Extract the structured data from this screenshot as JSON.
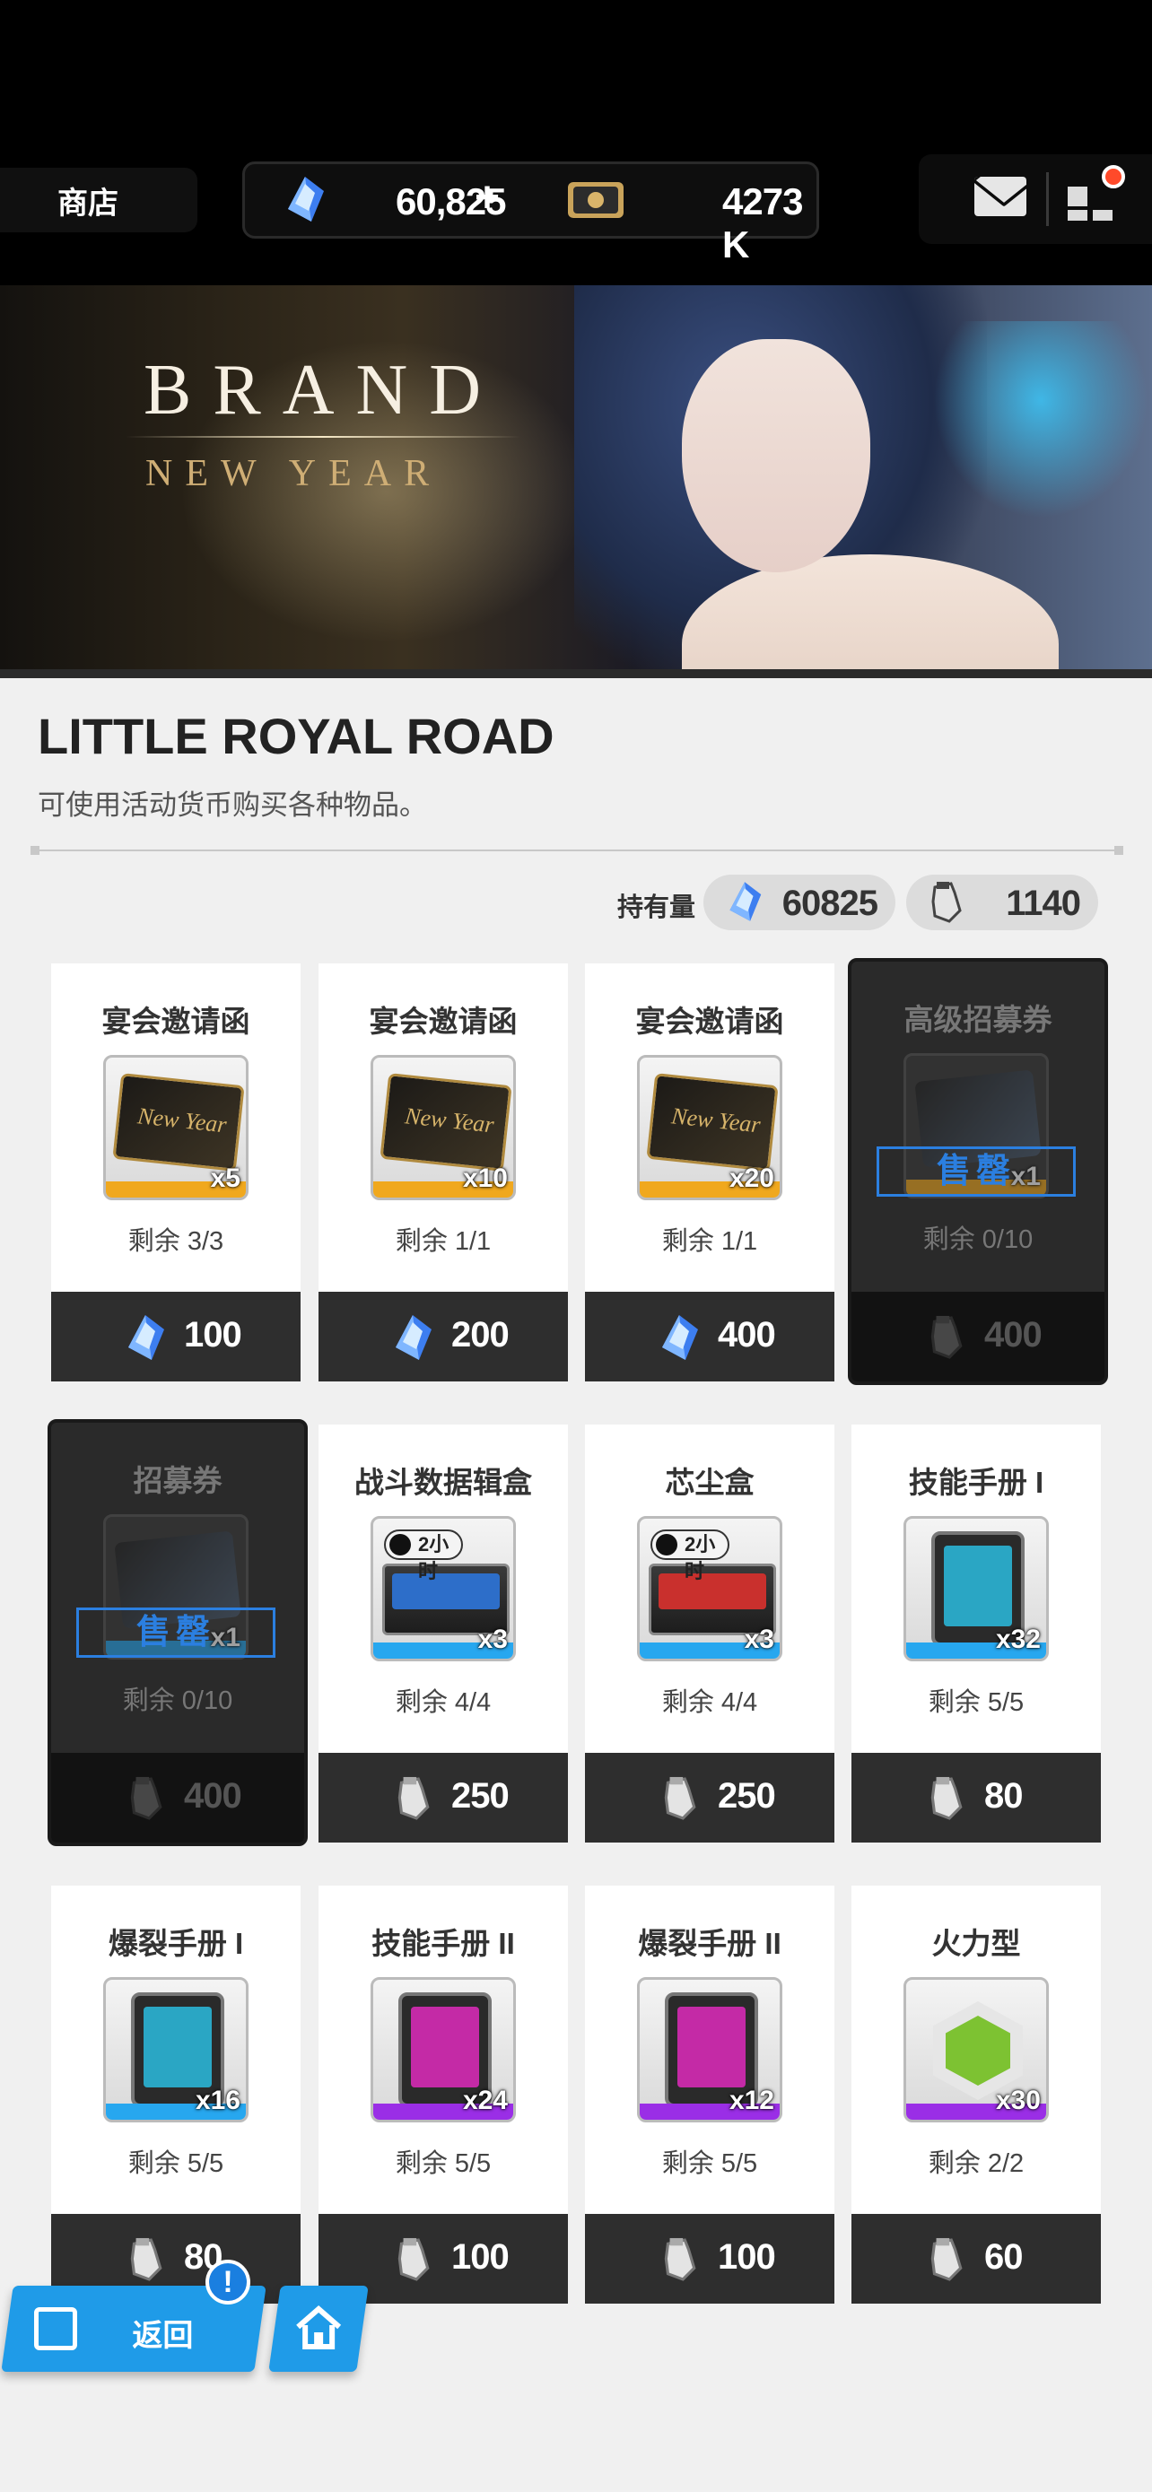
{
  "header": {
    "tab_label": "商店",
    "currency_gem": "60,825",
    "currency_credit": "4273 K",
    "add_symbol": "+"
  },
  "banner": {
    "title": "BRAND",
    "subtitle": "NEW YEAR"
  },
  "section": {
    "title": "LITTLE ROYAL ROAD",
    "description": "可使用活动货币购买各种物品。"
  },
  "holdings": {
    "label": "持有量",
    "gem": "60825",
    "token": "1140"
  },
  "sold_out_label": "售罄",
  "items": [
    {
      "name": "宴会邀请函",
      "qty": "x5",
      "remain": "剩余 3/3",
      "price": "100",
      "currency": "gem",
      "rarity": "gold",
      "sold_out": false
    },
    {
      "name": "宴会邀请函",
      "qty": "x10",
      "remain": "剩余 1/1",
      "price": "200",
      "currency": "gem",
      "rarity": "gold",
      "sold_out": false
    },
    {
      "name": "宴会邀请函",
      "qty": "x20",
      "remain": "剩余 1/1",
      "price": "400",
      "currency": "gem",
      "rarity": "gold",
      "sold_out": false
    },
    {
      "name": "高级招募券",
      "qty": "x1",
      "remain": "剩余 0/10",
      "price": "400",
      "currency": "token",
      "rarity": "gold",
      "sold_out": true
    },
    {
      "name": "招募券",
      "qty": "x1",
      "remain": "剩余 0/10",
      "price": "400",
      "currency": "token",
      "rarity": "blue",
      "sold_out": true
    },
    {
      "name": "战斗数据辑盒",
      "qty": "x3",
      "remain": "剩余 4/4",
      "price": "250",
      "currency": "token",
      "rarity": "blue",
      "timer": "2小时",
      "sold_out": false
    },
    {
      "name": "芯尘盒",
      "qty": "x3",
      "remain": "剩余 4/4",
      "price": "250",
      "currency": "token",
      "rarity": "blue",
      "timer": "2小时",
      "sold_out": false
    },
    {
      "name": "技能手册 I",
      "qty": "x32",
      "remain": "剩余 5/5",
      "price": "80",
      "currency": "token",
      "rarity": "blue",
      "sold_out": false
    },
    {
      "name": "爆裂手册 I",
      "qty": "x16",
      "remain": "剩余 5/5",
      "price": "80",
      "currency": "token",
      "rarity": "blue",
      "sold_out": false
    },
    {
      "name": "技能手册 II",
      "qty": "x24",
      "remain": "剩余 5/5",
      "price": "100",
      "currency": "token",
      "rarity": "purple",
      "sold_out": false
    },
    {
      "name": "爆裂手册 II",
      "qty": "x12",
      "remain": "剩余 5/5",
      "price": "100",
      "currency": "token",
      "rarity": "purple",
      "sold_out": false
    },
    {
      "name": "火力型",
      "qty": "x30",
      "remain": "剩余 2/2",
      "price": "60",
      "currency": "token",
      "rarity": "purple",
      "sold_out": false
    }
  ],
  "nav": {
    "back_label": "返回",
    "alert": "!"
  },
  "colors": {
    "accent_blue": "#1f9be8",
    "sold_stamp": "#2b7fe0",
    "rarity_gold": "#f0a81e",
    "rarity_blue": "#27a7ef",
    "rarity_purple": "#9a2ee6"
  }
}
